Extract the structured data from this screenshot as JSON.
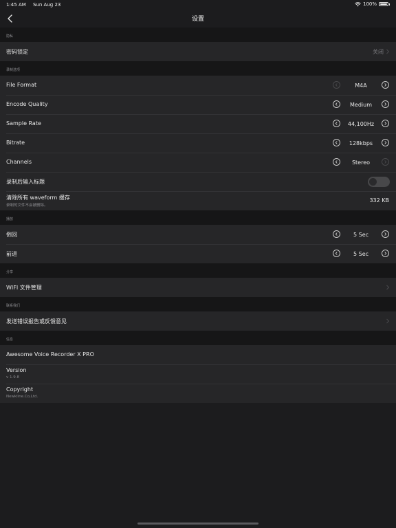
{
  "status": {
    "time": "1:45 AM",
    "date": "Sun Aug 23",
    "battery": "100%"
  },
  "nav": {
    "title": "设置"
  },
  "sections": {
    "privacy": {
      "header": "隐私",
      "passcode": {
        "label": "密码锁定",
        "value": "关闭"
      }
    },
    "recording": {
      "header": "录制选项",
      "file_format": {
        "label": "File Format",
        "value": "M4A"
      },
      "encode_quality": {
        "label": "Encode Quality",
        "value": "Medium"
      },
      "sample_rate": {
        "label": "Sample Rate",
        "value": "44,100Hz"
      },
      "bitrate": {
        "label": "Bitrate",
        "value": "128kbps"
      },
      "channels": {
        "label": "Channels",
        "value": "Stereo"
      },
      "title_after_record": {
        "label": "录制后输入标题"
      },
      "clear_cache": {
        "label": "清除所有 waveform 缓存",
        "sub": "录制的文件不会被删除。",
        "value": "332 KB"
      }
    },
    "playback": {
      "header": "播放",
      "rewind": {
        "label": "倒回",
        "value": "5 Sec"
      },
      "forward": {
        "label": "前进",
        "value": "5 Sec"
      }
    },
    "share": {
      "header": "分享",
      "wifi": {
        "label": "WIFI 文件管理"
      }
    },
    "contact": {
      "header": "联系我们",
      "feedback": {
        "label": "发送错误报告或反馈意见"
      }
    },
    "info": {
      "header": "信息",
      "app_name": {
        "label": "Awesome Voice Recorder X PRO"
      },
      "version": {
        "label": "Version",
        "value": "v 1.9.8"
      },
      "copyright": {
        "label": "Copyright",
        "value": "Newkline.Co,Ltd."
      }
    }
  },
  "colors": {
    "background": "#1c1c1e",
    "row": "#262628",
    "section": "#161617",
    "secondary_text": "#8a8a8e"
  }
}
